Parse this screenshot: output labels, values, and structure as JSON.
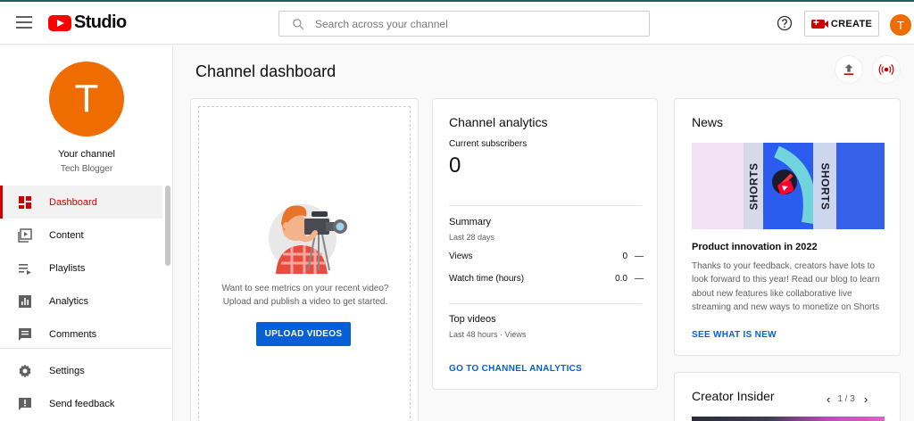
{
  "app": {
    "logo_text": "Studio",
    "brand_color": "#ff0000",
    "accent_color": "#065fd4",
    "active_color": "#cc0000"
  },
  "header": {
    "search_placeholder": "Search across your channel",
    "create_label": "CREATE",
    "avatar_letter": "T",
    "icons": [
      "menu-icon",
      "search-icon",
      "help-icon",
      "create-video-icon"
    ]
  },
  "sidebar": {
    "avatar_letter": "T",
    "channel_label": "Your channel",
    "channel_name": "Tech Blogger",
    "items": [
      {
        "label": "Dashboard",
        "icon": "dashboard-icon",
        "active": true
      },
      {
        "label": "Content",
        "icon": "content-icon"
      },
      {
        "label": "Playlists",
        "icon": "playlists-icon"
      },
      {
        "label": "Analytics",
        "icon": "analytics-icon"
      },
      {
        "label": "Comments",
        "icon": "comments-icon"
      },
      {
        "label": "Settings",
        "icon": "settings-icon"
      },
      {
        "label": "Send feedback",
        "icon": "feedback-icon"
      }
    ]
  },
  "main": {
    "title": "Channel dashboard",
    "actions": [
      "upload-icon",
      "go-live-icon"
    ],
    "upload_card": {
      "prompt_line1": "Want to see metrics on your recent video?",
      "prompt_line2": "Upload and publish a video to get started.",
      "button_label": "UPLOAD VIDEOS"
    },
    "analytics_card": {
      "title": "Channel analytics",
      "subscribers_label": "Current subscribers",
      "subscribers_value": "0",
      "summary_title": "Summary",
      "summary_period": "Last 28 days",
      "rows": [
        {
          "label": "Views",
          "value": "0",
          "trend": "—"
        },
        {
          "label": "Watch time (hours)",
          "value": "0.0",
          "trend": "—"
        }
      ],
      "top_videos_title": "Top videos",
      "top_videos_period": "Last 48 hours · Views",
      "link_label": "GO TO CHANNEL ANALYTICS"
    },
    "news_card": {
      "title": "News",
      "image_text": "SHORTS",
      "headline": "Product innovation in 2022",
      "body": "Thanks to your feedback, creators have lots to look forward to this year! Read our blog to learn about new features like collaborative live streaming and new ways to monetize on Shorts",
      "link_label": "SEE WHAT IS NEW"
    },
    "insider_card": {
      "title": "Creator Insider",
      "page": "1 / 3"
    }
  }
}
